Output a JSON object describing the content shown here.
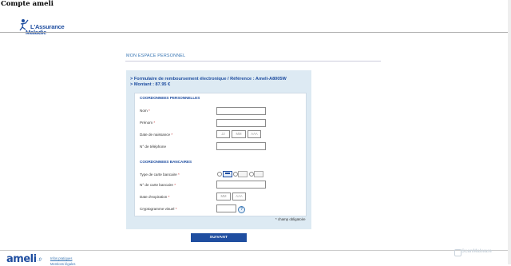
{
  "page": {
    "heading": "Compte ameli"
  },
  "header": {
    "logo_line1": "L'Assurance",
    "logo_line2": "Maladie"
  },
  "section": {
    "title": "MON ESPACE PERSONNEL"
  },
  "form": {
    "reference_line": "> Formulaire de remboursement électronique / Référence : Ameli-A8005W",
    "amount_line": "> Montant : 87.95 €",
    "personal": {
      "title": "COORDONNEES PERSONNELLES",
      "nom_label": "Nom",
      "prenom_label": "Prénom",
      "birth_label": "Date de naissance",
      "birth_day_placeholder": "JJ",
      "birth_month_placeholder": "MM",
      "birth_year_placeholder": "AAA",
      "phone_label": "N° de téléphone"
    },
    "bank": {
      "title": "COORDONNEES BANCAIRES",
      "card_type_label": "Type de carte bancaire",
      "card_number_label": "N° de carte bancaire",
      "expiry_label": "Date d'expiration",
      "expiry_month_placeholder": "MM",
      "expiry_year_placeholder": "AAA",
      "cvv_label": "Cryptogramme visuel",
      "help_glyph": "?"
    },
    "required_marker": "*",
    "required_note": "* champ obligatoire",
    "submit_label": "SUIVANT"
  },
  "footer": {
    "brand": "ameli",
    "brand_suffix": ".fr",
    "link1": "Infos pratiques",
    "link2": "Mentions légales"
  },
  "watermark": {
    "text": "ScanMalware"
  },
  "colors": {
    "brand_blue": "#1f4ea0",
    "link_blue": "#3a77b4",
    "form_background": "#ddeaf3"
  },
  "icons": {
    "logo": "assurance-maladie-figure-icon",
    "help": "question-mark-icon",
    "card_types": [
      "cb-card-icon",
      "visa-card-icon",
      "mastercard-card-icon"
    ]
  }
}
